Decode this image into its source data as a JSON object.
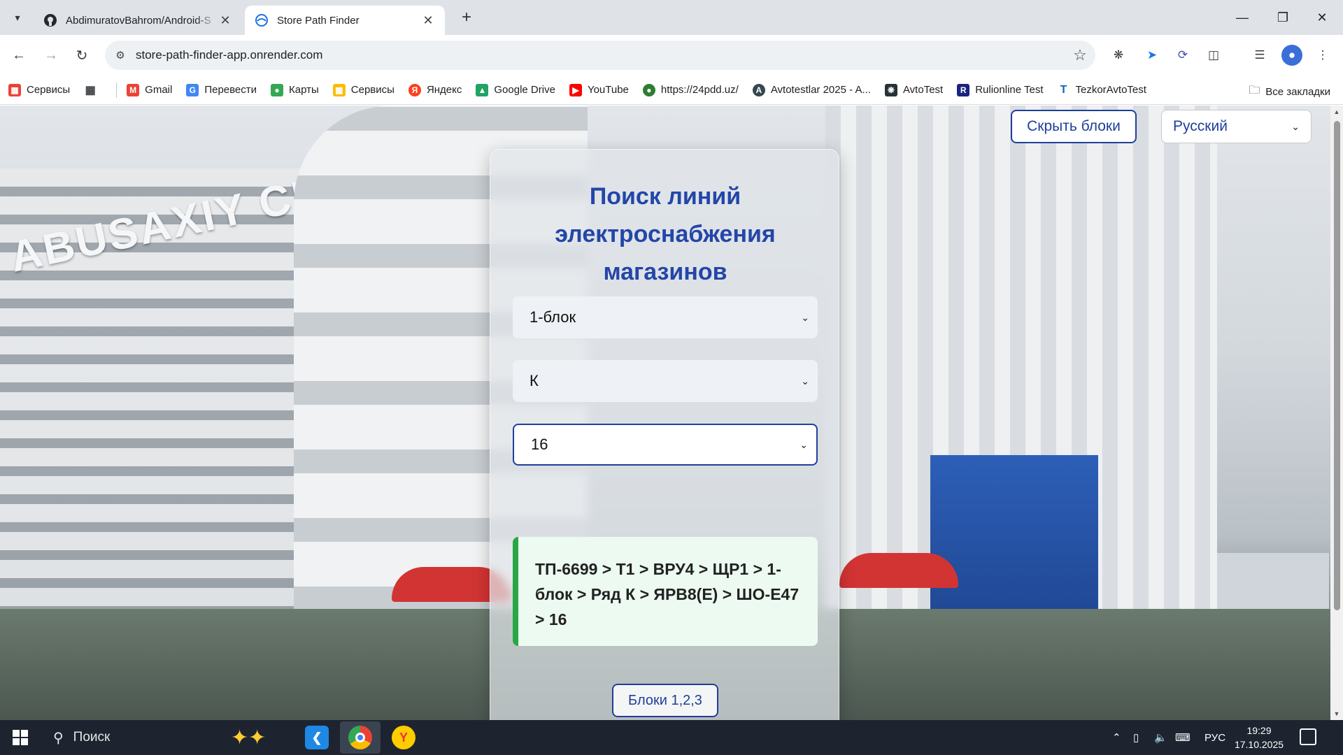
{
  "browser": {
    "tabs": [
      {
        "title": "AbdimuratovBahrom/Android-S",
        "favicon": "github-icon",
        "active": false
      },
      {
        "title": "Store Path Finder",
        "favicon": "site-icon",
        "active": true
      }
    ],
    "address": {
      "url": "store-path-finder-app.onrender.com"
    },
    "bookmarks": [
      {
        "label": "Сервисы",
        "icon": "apps-icon",
        "color": "#ea4335"
      },
      {
        "label": "Gmail",
        "icon": "gmail-icon",
        "color": "#ea4335"
      },
      {
        "label": "Перевести",
        "icon": "translate-icon",
        "color": "#4285f4"
      },
      {
        "label": "Карты",
        "icon": "maps-icon",
        "color": "#34a853"
      },
      {
        "label": "Сервисы",
        "icon": "apps-icon",
        "color": "#fbbc05"
      },
      {
        "label": "Яндекс",
        "icon": "yandex-icon",
        "color": "#fc3f1d"
      },
      {
        "label": "Google Drive",
        "icon": "drive-icon",
        "color": "#1fa463"
      },
      {
        "label": "YouTube",
        "icon": "youtube-icon",
        "color": "#ff0000"
      },
      {
        "label": "https://24pdd.uz/",
        "icon": "pdd-icon",
        "color": "#2e7d32"
      },
      {
        "label": "Avtotestlar 2025 - A...",
        "icon": "avtotestlar-icon",
        "color": "#37474f"
      },
      {
        "label": "AvtoTest",
        "icon": "avtotest-icon",
        "color": "#263238"
      },
      {
        "label": "Rulionline Test",
        "icon": "rulionline-icon",
        "color": "#1a237e"
      },
      {
        "label": "TezkorAvtoTest",
        "icon": "tezkor-icon",
        "color": "#1565c0"
      }
    ],
    "all_bookmarks": "Все закладки"
  },
  "page": {
    "hide_blocks_button": "Скрыть блоки",
    "language": "Русский",
    "title": "Поиск линий электроснабжения магазинов",
    "block_select": "1-блок",
    "row_select": "К",
    "number_select": "16",
    "result": "ТП-6699 > Т1 > ВРУ4 > ЩР1 > 1-блок > Ряд К > ЯРВ8(Е) > ШО-Е47 > 16",
    "blocks_button": "Блоки 1,2,3",
    "background_sign": "ABUSAXIY CEN"
  },
  "taskbar": {
    "search_placeholder": "Поиск",
    "language": "РУС",
    "time": "19:29",
    "date": "17.10.2025"
  },
  "colors": {
    "accent": "#1f3f9a",
    "title": "#2446a8",
    "result_border": "#28a745",
    "result_bg": "#ecfaf1"
  }
}
